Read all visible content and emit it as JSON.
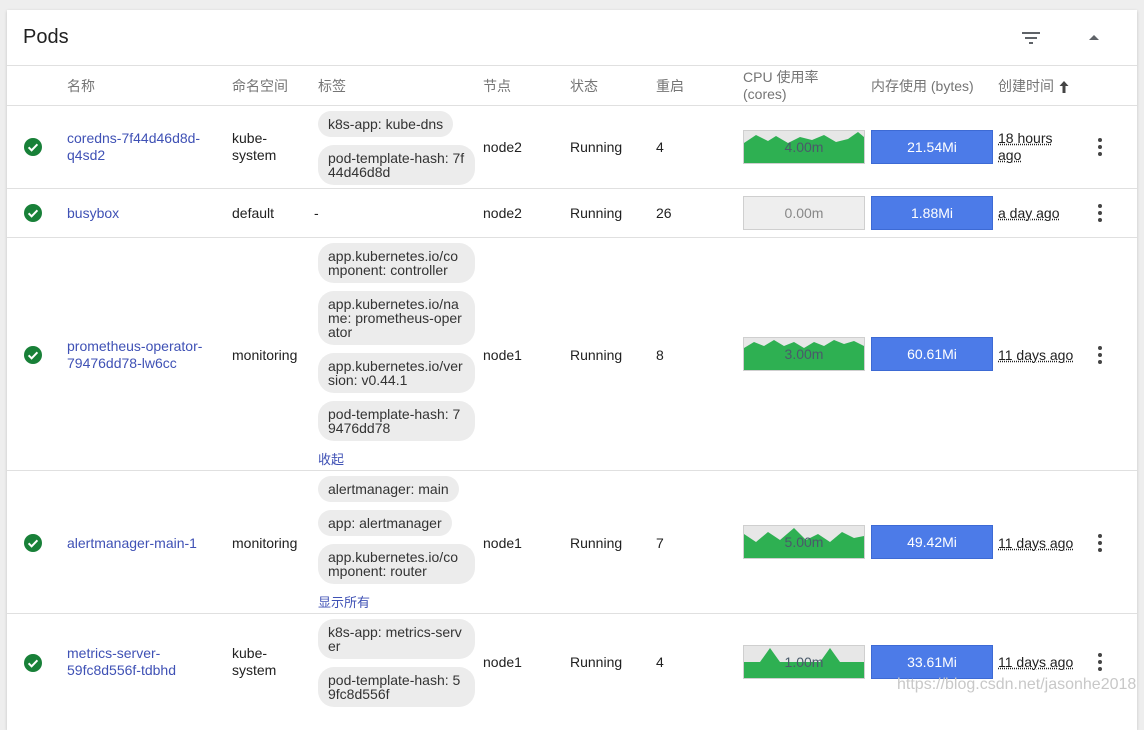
{
  "title": "Pods",
  "columns": {
    "name": "名称",
    "namespace": "命名空间",
    "labels": "标签",
    "node": "节点",
    "status": "状态",
    "restarts": "重启",
    "cpu": "CPU 使用率",
    "cpu_unit": "(cores)",
    "memory": "内存使用 (bytes)",
    "created": "创建时间"
  },
  "rows": [
    {
      "name": "coredns-7f44d46d8d-q4sd2",
      "name_line1": "coredns-7f44d46d8d-",
      "name_line2": "q4sd2",
      "namespace_line1": "kube-",
      "namespace_line2": "system",
      "labels": [
        "k8s-app: kube-dns",
        "pod-template-hash: 7f44d46d8d"
      ],
      "node": "node2",
      "status": "Running",
      "restarts": "4",
      "cpu": "4.00m",
      "memory": "21.54Mi",
      "age_line1": "18 hours",
      "age_line2": "ago"
    },
    {
      "name": "busybox",
      "namespace": "default",
      "labels_text": "-",
      "node": "node2",
      "status": "Running",
      "restarts": "26",
      "cpu": "0.00m",
      "memory": "1.88Mi",
      "age": "a day ago"
    },
    {
      "name": "prometheus-operator-79476dd78-lw6cc",
      "name_line1": "prometheus-operator-",
      "name_line2": "79476dd78-lw6cc",
      "namespace": "monitoring",
      "labels": [
        "app.kubernetes.io/component: controller",
        "app.kubernetes.io/name: prometheus-operator",
        "app.kubernetes.io/version: v0.44.1",
        "pod-template-hash: 79476dd78"
      ],
      "labels_toggle": "收起",
      "node": "node1",
      "status": "Running",
      "restarts": "8",
      "cpu": "3.00m",
      "memory": "60.61Mi",
      "age": "11 days ago"
    },
    {
      "name": "alertmanager-main-1",
      "namespace": "monitoring",
      "labels": [
        "alertmanager: main",
        "app: alertmanager",
        "app.kubernetes.io/component: router"
      ],
      "labels_toggle": "显示所有",
      "node": "node1",
      "status": "Running",
      "restarts": "7",
      "cpu": "5.00m",
      "memory": "49.42Mi",
      "age": "11 days ago"
    },
    {
      "name": "metrics-server-59fc8d556f-tdbhd",
      "name_line1": "metrics-server-",
      "name_line2": "59fc8d556f-tdbhd",
      "namespace_line1": "kube-",
      "namespace_line2": "system",
      "labels": [
        "k8s-app: metrics-server",
        "pod-template-hash: 59fc8d556f"
      ],
      "node": "node1",
      "status": "Running",
      "restarts": "4",
      "cpu": "1.00m",
      "memory": "33.61Mi",
      "age": "11 days ago"
    }
  ],
  "watermark": "https://blog.csdn.net/jasonhe2018",
  "colors": {
    "link": "#3f51b5",
    "status_ok": "#188038",
    "cpu_fill": "#2eb052",
    "memory_fill": "#4c7be8"
  },
  "icons": [
    "filter-icon",
    "collapse-icon",
    "sort-arrow-up-icon",
    "check-circle-icon",
    "more-vert-icon"
  ]
}
